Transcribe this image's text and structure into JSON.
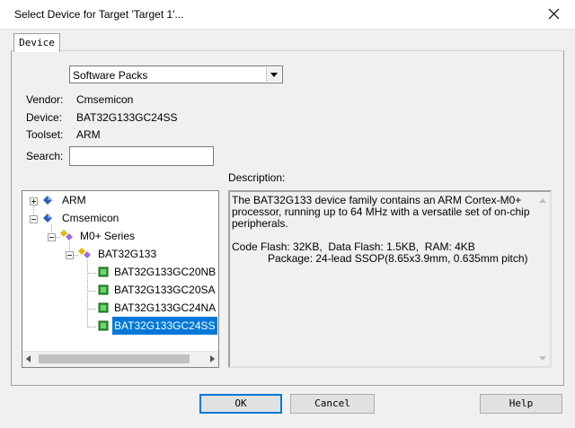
{
  "window": {
    "title": "Select Device for Target 'Target 1'..."
  },
  "tabs": [
    {
      "label": "Device"
    }
  ],
  "database": {
    "selected": "Software Packs"
  },
  "info": {
    "vendor_label": "Vendor:",
    "vendor_value": "Cmsemicon",
    "device_label": "Device:",
    "device_value": "BAT32G133GC24SS",
    "toolset_label": "Toolset:",
    "toolset_value": "ARM",
    "search_label": "Search:",
    "search_value": ""
  },
  "description": {
    "label": "Description:",
    "text": "The BAT32G133 device family contains an ARM Cortex-M0+\nprocessor, running up to 64 MHz with a versatile set of on-chip\nperipherals.\n\nCode Flash: 32KB,  Data Flash: 1.5KB,  RAM: 4KB\n            Package: 24-lead SSOP(8.65x3.9mm, 0.635mm pitch)"
  },
  "tree": {
    "arm": "ARM",
    "cmsemicon": "Cmsemicon",
    "series": "M0+ Series",
    "family": "BAT32G133",
    "devices": [
      "BAT32G133GC20NB",
      "BAT32G133GC20SA",
      "BAT32G133GC24NA",
      "BAT32G133GC24SS"
    ],
    "selected_index": 3
  },
  "buttons": {
    "ok": "OK",
    "cancel": "Cancel",
    "help": "Help"
  },
  "colors": {
    "selection": "#0078d7",
    "chip_green": "#2e9e2e",
    "vendor_blue": "#2a5cb8"
  }
}
